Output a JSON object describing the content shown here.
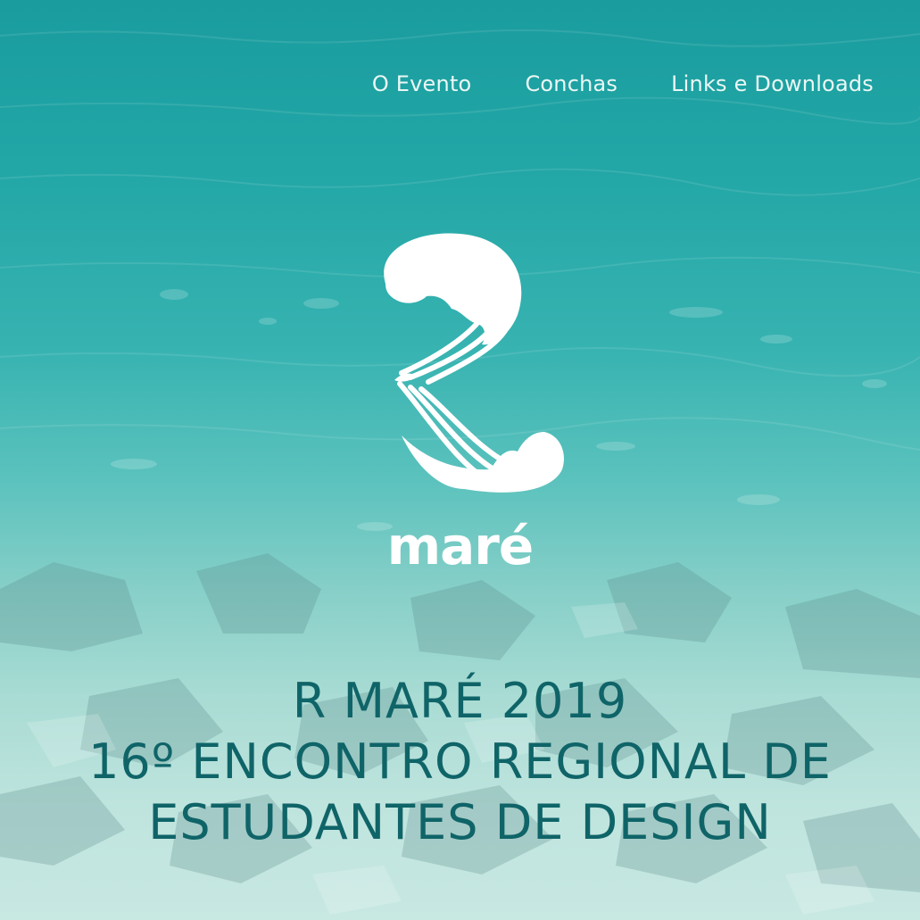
{
  "nav": {
    "items": [
      {
        "label": "O Evento"
      },
      {
        "label": "Conchas"
      },
      {
        "label": "Links e Downloads"
      }
    ]
  },
  "logo": {
    "wordmark": "maré"
  },
  "headline": {
    "line1": "R MARÉ 2019",
    "line2": "16º ENCONTRO REGIONAL DE",
    "line3": "ESTUDANTES DE DESIGN"
  },
  "colors": {
    "water_top": "#1a9c9e",
    "water_bottom": "#c8e8e2",
    "headline_text": "#0f6468",
    "nav_text": "#eaf7f5"
  }
}
